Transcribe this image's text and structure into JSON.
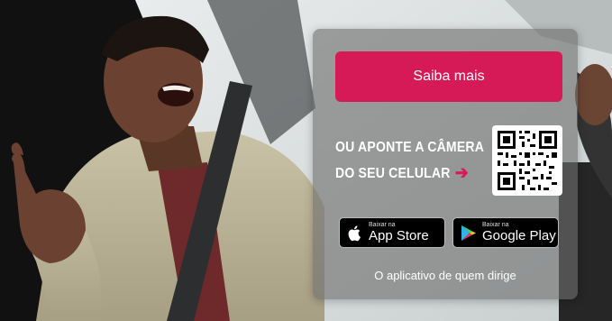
{
  "banner": {
    "cta_label": "Saiba mais",
    "qr_line1": "OU APONTE A CÂMERA",
    "qr_line2": "DO SEU CELULAR",
    "app_store_small": "Baixar na",
    "app_store_large": "App Store",
    "google_play_small": "Baixar na",
    "google_play_large": "Google Play",
    "tagline": "O aplicativo de quem dirige"
  },
  "colors": {
    "accent": "#d61a58",
    "panel": "rgba(110,110,110,0.62)"
  },
  "icons": [
    "apple-icon",
    "google-play-icon",
    "arrow-right-icon",
    "qr-code"
  ]
}
